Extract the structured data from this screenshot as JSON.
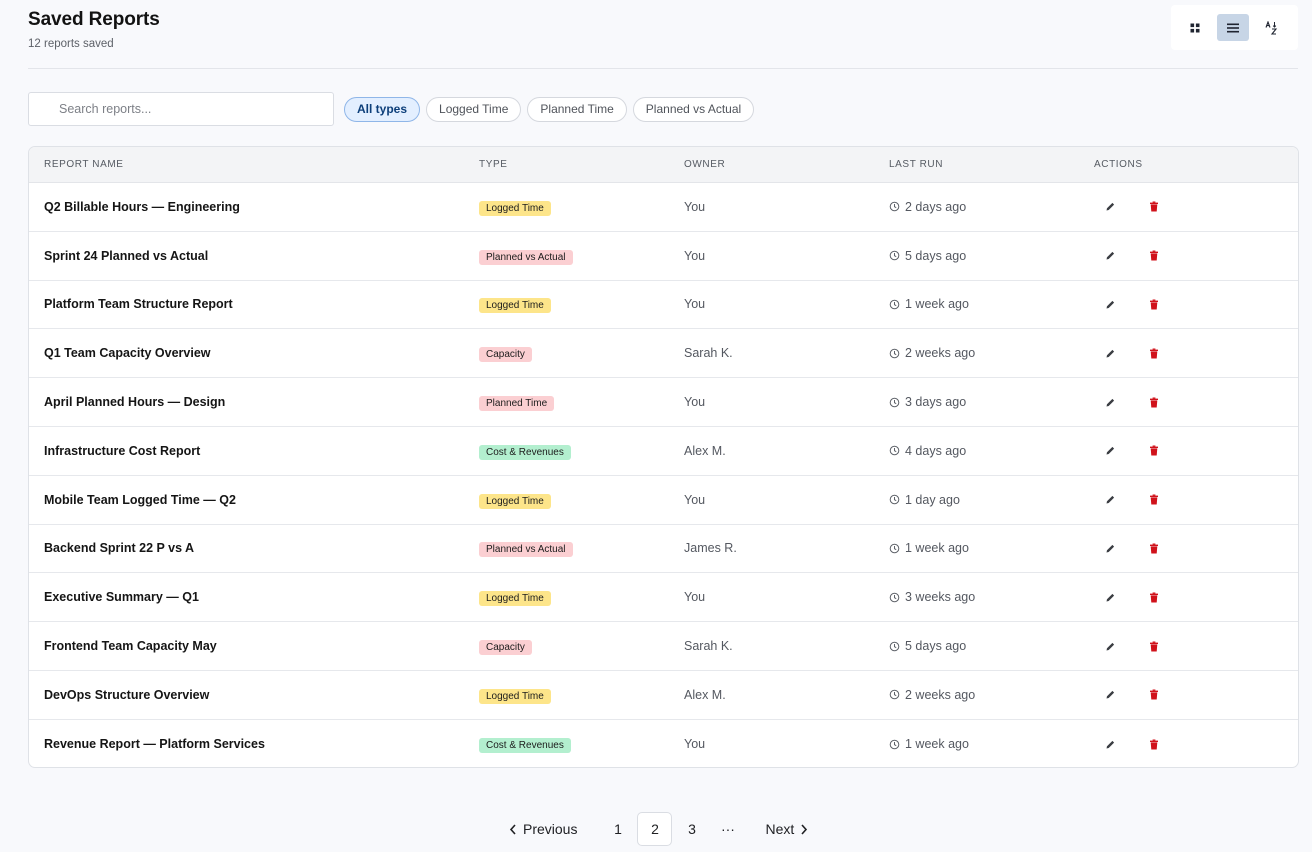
{
  "header": {
    "title": "Saved Reports",
    "subtitle": "12 reports saved"
  },
  "view_modes": [
    {
      "icon": "grid-view-icon",
      "active": false
    },
    {
      "icon": "list-view-icon",
      "active": true
    },
    {
      "icon": "sort-az-icon",
      "active": false
    }
  ],
  "search": {
    "placeholder": "Search reports...",
    "value": ""
  },
  "filters": [
    {
      "label": "All types",
      "active": true
    },
    {
      "label": "Logged Time",
      "active": false
    },
    {
      "label": "Planned Time",
      "active": false
    },
    {
      "label": "Planned vs Actual",
      "active": false
    }
  ],
  "table": {
    "columns": [
      "REPORT NAME",
      "TYPE",
      "OWNER",
      "LAST RUN",
      "ACTIONS"
    ],
    "rows": [
      {
        "name": "Q2 Billable Hours — Engineering",
        "type": "Logged Time",
        "owner": "You",
        "last_run": "2 days ago"
      },
      {
        "name": "Sprint 24 Planned vs Actual",
        "type": "Planned vs Actual",
        "owner": "You",
        "last_run": "5 days ago"
      },
      {
        "name": "Platform Team Structure Report",
        "type": "Logged Time",
        "owner": "You",
        "last_run": "1 week ago"
      },
      {
        "name": "Q1 Team Capacity Overview",
        "type": "Capacity",
        "owner": "Sarah K.",
        "last_run": "2 weeks ago"
      },
      {
        "name": "April Planned Hours — Design",
        "type": "Planned Time",
        "owner": "You",
        "last_run": "3 days ago"
      },
      {
        "name": "Infrastructure Cost Report",
        "type": "Cost & Revenues",
        "owner": "Alex M.",
        "last_run": "4 days ago"
      },
      {
        "name": "Mobile Team Logged Time — Q2",
        "type": "Logged Time",
        "owner": "You",
        "last_run": "1 day ago"
      },
      {
        "name": "Backend Sprint 22 P vs A",
        "type": "Planned vs Actual",
        "owner": "James R.",
        "last_run": "1 week ago"
      },
      {
        "name": "Executive Summary — Q1",
        "type": "Logged Time",
        "owner": "You",
        "last_run": "3 weeks ago"
      },
      {
        "name": "Frontend Team Capacity May",
        "type": "Capacity",
        "owner": "Sarah K.",
        "last_run": "5 days ago"
      },
      {
        "name": "DevOps Structure Overview",
        "type": "Logged Time",
        "owner": "Alex M.",
        "last_run": "2 weeks ago"
      },
      {
        "name": "Revenue Report — Platform Services",
        "type": "Cost & Revenues",
        "owner": "You",
        "last_run": "1 week ago"
      }
    ]
  },
  "type_colors": {
    "Logged Time": "#fde58a",
    "Planned vs Actual": "#fbcfd2",
    "Capacity": "#fbcfd2",
    "Planned Time": "#fbcfd2",
    "Cost & Revenues": "#b3efcf"
  },
  "colors": {
    "delete_icon": "#d0121b",
    "edit_icon": "#3a3d42",
    "accent": "#8fb6e8"
  },
  "pagination": {
    "previous_label": "Previous",
    "next_label": "Next",
    "pages": [
      "1",
      "2",
      "3"
    ],
    "current": "2",
    "ellipsis": "···"
  }
}
